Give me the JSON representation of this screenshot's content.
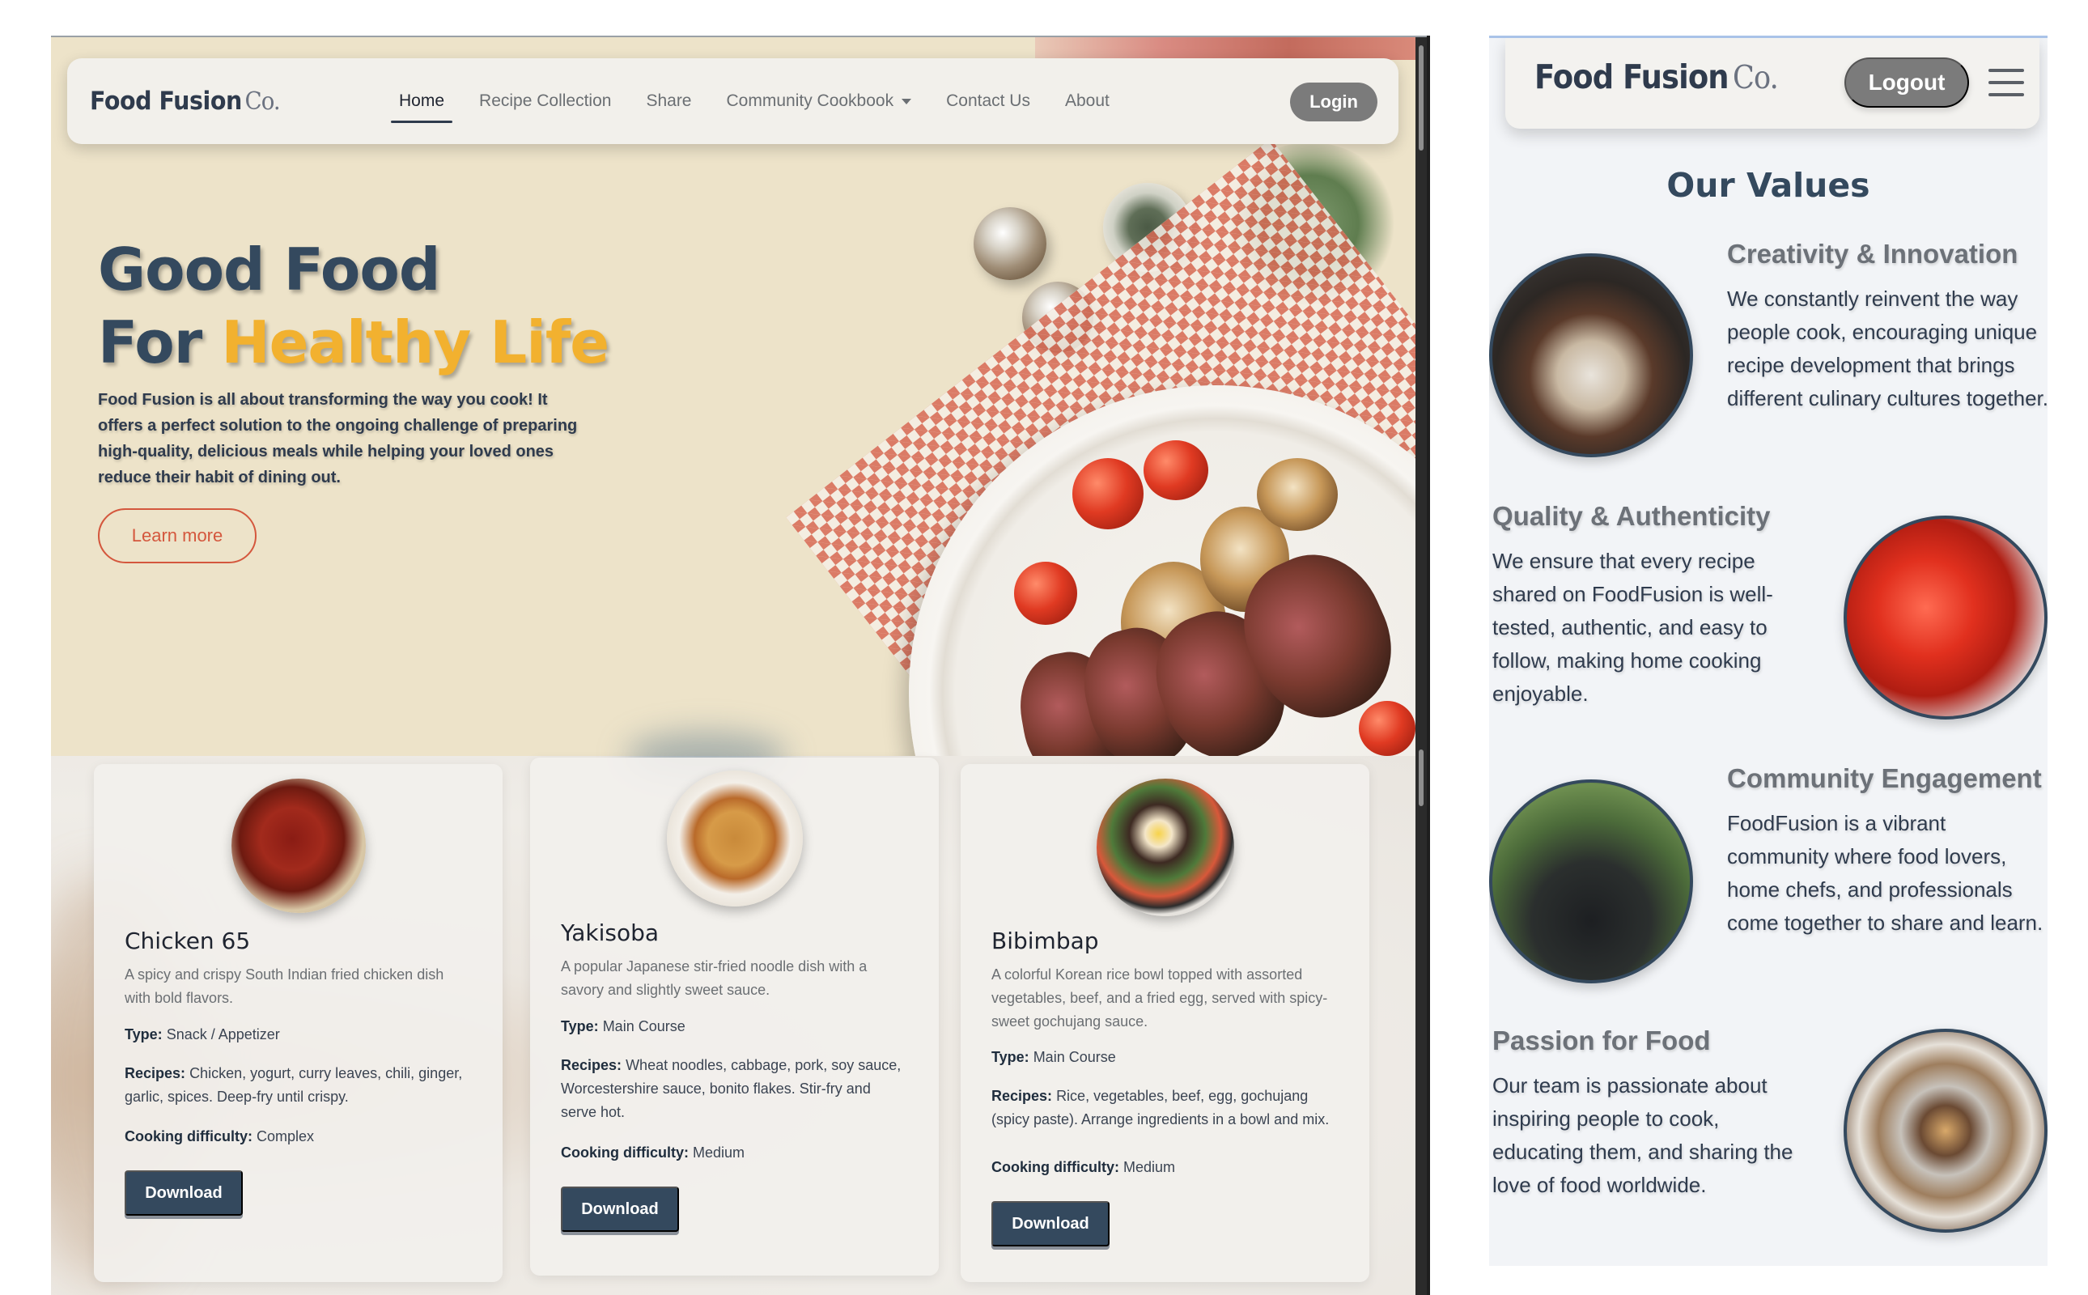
{
  "desktop": {
    "brand": {
      "name": "Food Fusion",
      "suffix": "Co."
    },
    "nav": {
      "links": [
        "Home",
        "Recipe Collection",
        "Share",
        "Community Cookbook",
        "Contact Us",
        "About"
      ],
      "active": "Home",
      "login_label": "Login"
    },
    "hero": {
      "title_line1": "Good Food",
      "title_line2_prefix": "For ",
      "title_line2_highlight": "Healthy Life",
      "description": "Food Fusion is all about transforming the way you cook! It offers a perfect solution to the ongoing challenge of preparing high-quality, delicious meals while helping your loved ones reduce their habit of dining out.",
      "cta_label": "Learn more"
    },
    "recipes": [
      {
        "name": "Chicken 65",
        "description": "A spicy and crispy South Indian fried chicken dish with bold flavors.",
        "type_label": "Type:",
        "type": "Snack / Appetizer",
        "recipes_label": "Recipes:",
        "recipes": "Chicken, yogurt, curry leaves, chili, ginger, garlic, spices. Deep-fry until crispy.",
        "difficulty_label": "Cooking difficulty:",
        "difficulty": "Complex",
        "download_label": "Download"
      },
      {
        "name": "Yakisoba",
        "description": "A popular Japanese stir-fried noodle dish with a savory and slightly sweet sauce.",
        "type_label": "Type:",
        "type": "Main Course",
        "recipes_label": "Recipes:",
        "recipes": "Wheat noodles, cabbage, pork, soy sauce, Worcestershire sauce, bonito flakes. Stir-fry and serve hot.",
        "difficulty_label": "Cooking difficulty:",
        "difficulty": "Medium",
        "download_label": "Download"
      },
      {
        "name": "Bibimbap",
        "description": "A colorful Korean rice bowl topped with assorted vegetables, beef, and a fried egg, served with spicy-sweet gochujang sauce.",
        "type_label": "Type:",
        "type": "Main Course",
        "recipes_label": "Recipes:",
        "recipes": "Rice, vegetables, beef, egg, gochujang (spicy paste). Arrange ingredients in a bowl and mix.",
        "difficulty_label": "Cooking difficulty:",
        "difficulty": "Medium",
        "download_label": "Download"
      }
    ]
  },
  "mobile": {
    "brand": {
      "name": "Food Fusion",
      "suffix": "Co."
    },
    "logout_label": "Logout",
    "heading": "Our Values",
    "values": [
      {
        "title": "Creativity & Innovation",
        "text": "We constantly reinvent the way people cook, encouraging unique recipe development that brings different culinary cultures together."
      },
      {
        "title": "Quality & Authenticity",
        "text": "We ensure that every recipe shared on FoodFusion is well-tested, authentic, and easy to follow, making home cooking enjoyable."
      },
      {
        "title": "Community Engagement",
        "text": "FoodFusion is a vibrant community where food lovers, home chefs, and professionals come together to share and learn."
      },
      {
        "title": "Passion for Food",
        "text": "Our team is passionate about inspiring people to cook, educating them, and sharing the love of food worldwide."
      }
    ]
  },
  "colors": {
    "navy": "#34495e",
    "accent_yellow": "#f2b12f",
    "accent_orange": "#d4573d",
    "login_gray": "#7b7b7b",
    "hero_bg": "#ede3c9"
  },
  "icons": [
    "hamburger-menu-icon",
    "dropdown-caret-icon"
  ]
}
